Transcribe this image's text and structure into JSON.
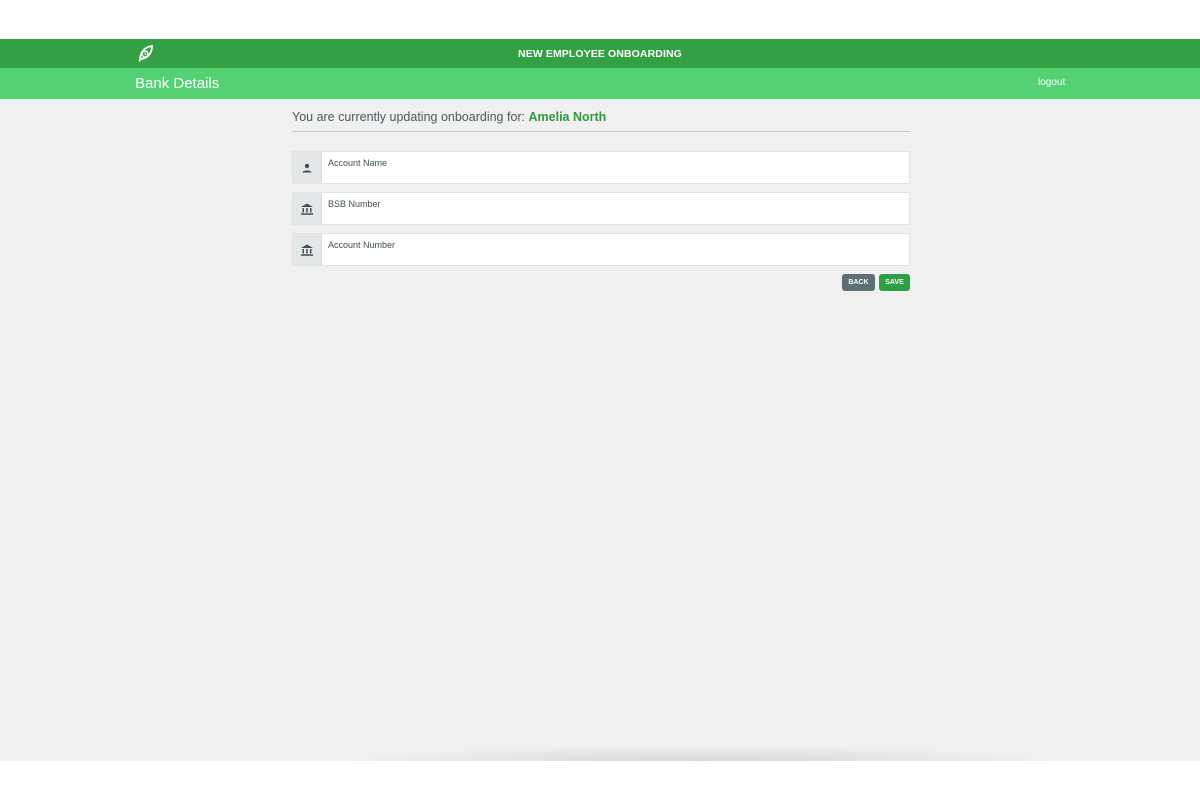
{
  "header": {
    "app_title": "NEW EMPLOYEE ONBOARDING",
    "logo_icon": "leaf-clock-icon",
    "brand_color": "#34a044",
    "accent_color": "#54d173"
  },
  "subheader": {
    "page_title": "Bank Details",
    "logout_label": "logout"
  },
  "intro": {
    "prefix": "You are currently updating onboarding for: ",
    "employee_name": "Amelia North"
  },
  "form": {
    "fields": [
      {
        "icon": "person-icon",
        "placeholder": "Account Name",
        "value": ""
      },
      {
        "icon": "bank-icon",
        "placeholder": "BSB Number",
        "value": ""
      },
      {
        "icon": "bank-icon",
        "placeholder": "Account Number",
        "value": ""
      }
    ],
    "back_label": "BACK",
    "save_label": "SAVE"
  }
}
